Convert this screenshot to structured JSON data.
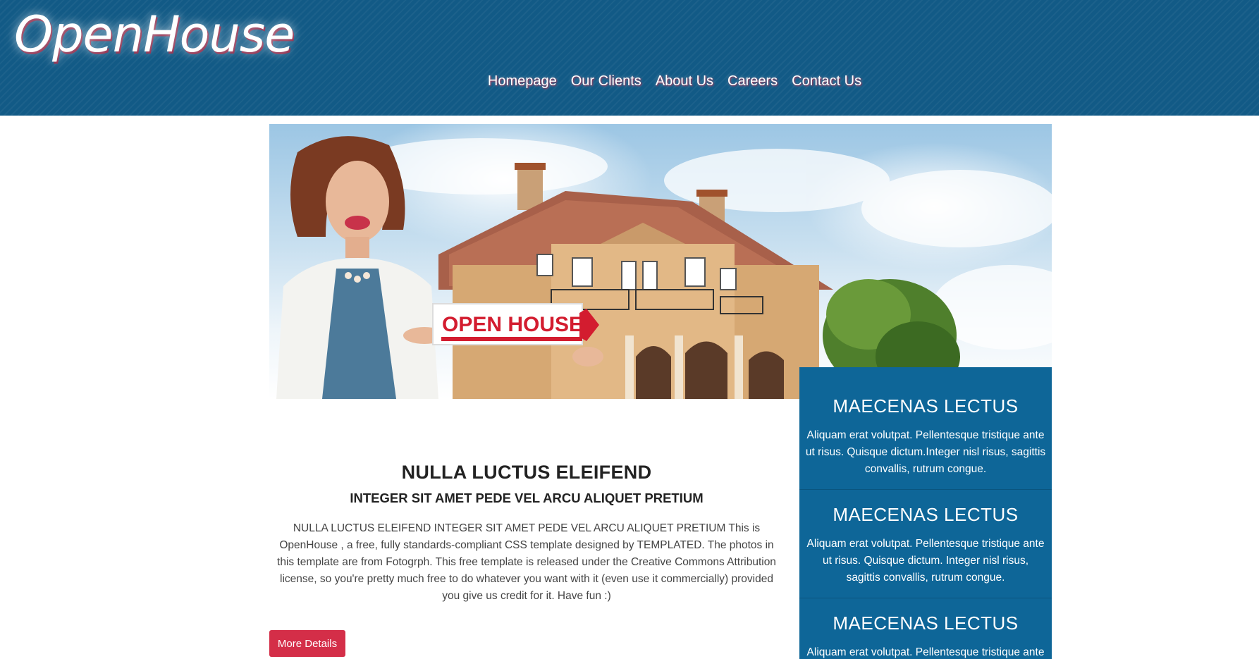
{
  "brand": {
    "logo": "OpenHouse"
  },
  "nav": {
    "items": [
      "Homepage",
      "Our Clients",
      "About Us",
      "Careers",
      "Contact Us"
    ]
  },
  "hero": {
    "sign_text": "OPEN HOUSE"
  },
  "sidebar": {
    "blocks": [
      {
        "title": "MAECENAS LECTUS",
        "text": "Aliquam erat volutpat. Pellentesque tristique ante ut risus. Quisque dictum.Integer nisl risus, sagittis convallis, rutrum congue."
      },
      {
        "title": "MAECENAS LECTUS",
        "text": "Aliquam erat volutpat. Pellentesque tristique ante ut risus. Quisque dictum. Integer nisl risus, sagittis convallis, rutrum congue."
      },
      {
        "title": "MAECENAS LECTUS",
        "text": "Aliquam erat volutpat. Pellentesque tristique ante"
      }
    ]
  },
  "main": {
    "title": "NULLA LUCTUS ELEIFEND",
    "subtitle": "INTEGER SIT AMET PEDE VEL ARCU ALIQUET PRETIUM",
    "body": "NULLA LUCTUS ELEIFEND INTEGER SIT AMET PEDE VEL ARCU ALIQUET PRETIUM This is OpenHouse , a free, fully standards-compliant CSS template designed by TEMPLATED. The photos in this template are from Fotogrph. This free template is released under the Creative Commons Attribution license, so you're pretty much free to do whatever you want with it (even use it commercially) provided you give us credit for it. Have fun :)",
    "button_label": "More Details"
  },
  "colors": {
    "header_bg": "#125a86",
    "sidebar_bg": "#0e6698",
    "button_bg": "#d42e48"
  }
}
